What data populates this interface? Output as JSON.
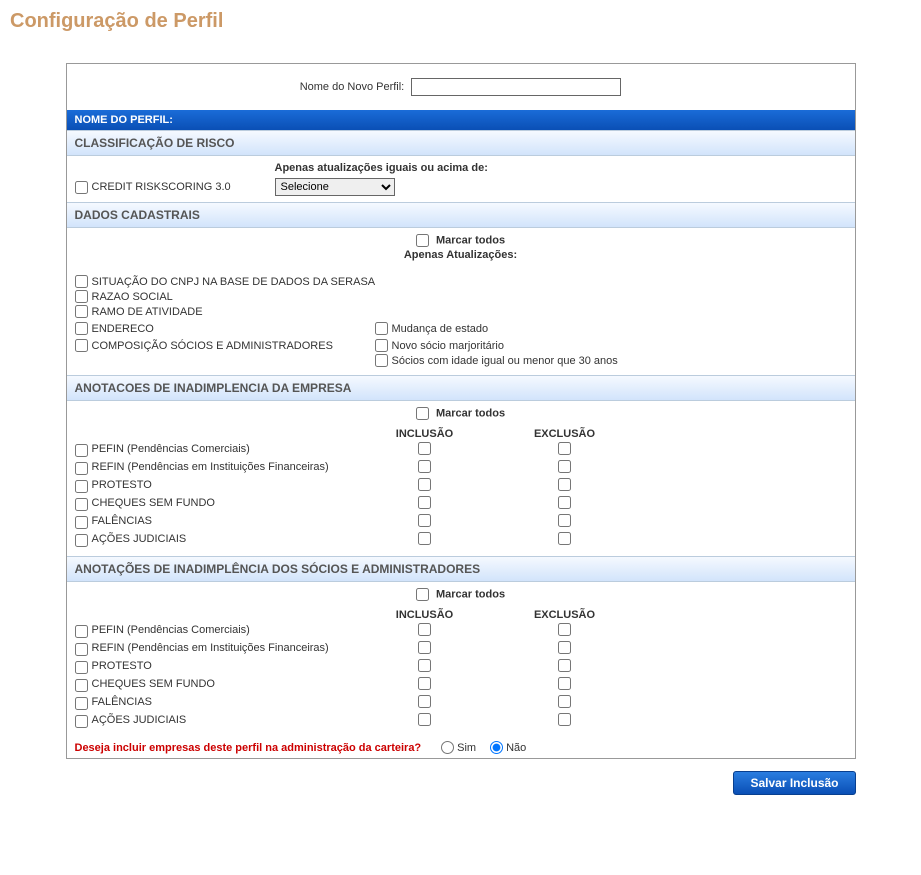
{
  "page_title": "Configuração de Perfil",
  "profile_name": {
    "label": "Nome do Novo Perfil:",
    "value": ""
  },
  "section_nome_perfil": "NOME DO PERFIL:",
  "section_risco": {
    "title": "CLASSIFICAÇÃO DE RISCO",
    "above_label": "Apenas atualizações iguais ou acima de:",
    "item": "CREDIT RISKSCORING 3.0",
    "select_placeholder": "Selecione"
  },
  "section_cadastrais": {
    "title": "DADOS CADASTRAIS",
    "marcar_todos": "Marcar todos",
    "apenas_atualiz": "Apenas Atualizações:",
    "items": [
      {
        "label": "SITUAÇÃO DO CNPJ NA BASE DE DADOS DA SERASA"
      },
      {
        "label": "RAZAO SOCIAL"
      },
      {
        "label": "RAMO DE ATIVIDADE"
      },
      {
        "label": "ENDERECO",
        "sub": [
          "Mudança de estado"
        ]
      },
      {
        "label": "COMPOSIÇÃO SÓCIOS E ADMINISTRADORES",
        "sub": [
          "Novo sócio marjoritário",
          "Sócios com idade igual ou menor que 30 anos"
        ]
      }
    ]
  },
  "section_inadimplencia_empresa": {
    "title": "ANOTACOES DE INADIMPLENCIA DA EMPRESA",
    "marcar_todos": "Marcar todos",
    "col_inc": "INCLUSÃO",
    "col_exc": "EXCLUSÃO",
    "items": [
      "PEFIN (Pendências Comerciais)",
      "REFIN (Pendências em Instituições Financeiras)",
      "PROTESTO",
      "CHEQUES SEM FUNDO",
      "FALÊNCIAS",
      "AÇÕES JUDICIAIS"
    ]
  },
  "section_inadimplencia_socios": {
    "title": "ANOTAÇÕES DE INADIMPLÊNCIA DOS SÓCIOS E ADMINISTRADORES",
    "marcar_todos": "Marcar todos",
    "col_inc": "INCLUSÃO",
    "col_exc": "EXCLUSÃO",
    "items": [
      "PEFIN (Pendências Comerciais)",
      "REFIN (Pendências em Instituições Financeiras)",
      "PROTESTO",
      "CHEQUES SEM FUNDO",
      "FALÊNCIAS",
      "AÇÕES JUDICIAIS"
    ]
  },
  "question": {
    "text": "Deseja incluir empresas deste perfil na administração da carteira?",
    "sim": "Sim",
    "nao": "Não"
  },
  "save_button": "Salvar Inclusão"
}
